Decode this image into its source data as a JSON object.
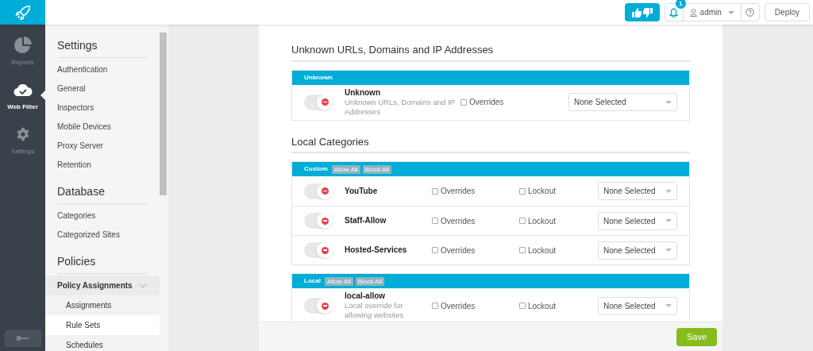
{
  "topbar": {
    "notification_count": "1",
    "user": "admin",
    "deploy": "Deploy"
  },
  "nav": [
    {
      "label": "Reports",
      "kind": "pie",
      "selected": false
    },
    {
      "label": "Web Filter",
      "kind": "cloud",
      "selected": true
    },
    {
      "label": "Settings",
      "kind": "gear",
      "selected": false
    }
  ],
  "sidebar": {
    "sections": [
      {
        "title": "Settings",
        "items": [
          {
            "label": "Authentication",
            "selected": false
          },
          {
            "label": "General",
            "selected": false
          },
          {
            "label": "Inspectors",
            "selected": false
          },
          {
            "label": "Mobile Devices",
            "selected": false
          },
          {
            "label": "Proxy Server",
            "selected": false
          },
          {
            "label": "Retention",
            "selected": false
          }
        ]
      },
      {
        "title": "Database",
        "items": [
          {
            "label": "Categories",
            "selected": false
          },
          {
            "label": "Categorized Sites",
            "selected": false
          }
        ]
      },
      {
        "title": "Policies",
        "items": [
          {
            "label": "Policy Assignments",
            "selected": false,
            "expanded": true,
            "children": [
              {
                "label": "Assignments",
                "selected": false
              },
              {
                "label": "Rule Sets",
                "selected": true
              },
              {
                "label": "Schedules",
                "selected": false
              }
            ]
          }
        ]
      }
    ]
  },
  "sections": [
    {
      "title": "Unknown URLs, Domains and IP Addresses",
      "groups": [
        {
          "title": "Unknown",
          "rows": [
            {
              "name": "Unknown",
              "description": "Unknown URLs, Domains and IP Addresses",
              "blocked": true,
              "overrides": {
                "label": "Overrides",
                "checked": false
              },
              "select": "None Selected"
            }
          ]
        }
      ]
    },
    {
      "title": "Local Categories",
      "groups": [
        {
          "title": "Custom",
          "actions": [
            "Allow All",
            "Block All"
          ],
          "rows": [
            {
              "name": "YouTube",
              "blocked": true,
              "overrides": {
                "label": "Overrides",
                "checked": false
              },
              "lockout": {
                "label": "Lockout",
                "checked": false
              },
              "select": "None Selected"
            },
            {
              "name": "Staff-Allow",
              "blocked": true,
              "overrides": {
                "label": "Overrides",
                "checked": false
              },
              "lockout": {
                "label": "Lockout",
                "checked": false
              },
              "select": "None Selected"
            },
            {
              "name": "Hosted-Services",
              "blocked": true,
              "overrides": {
                "label": "Overrides",
                "checked": false
              },
              "lockout": {
                "label": "Lockout",
                "checked": false
              },
              "select": "None Selected"
            }
          ]
        },
        {
          "title": "Local",
          "actions": [
            "Allow All",
            "Block All"
          ],
          "rows": [
            {
              "name": "local-allow",
              "description": "Local override for allowing websites",
              "blocked": true,
              "overrides": {
                "label": "Overrides",
                "checked": false
              },
              "lockout": {
                "label": "Lockout",
                "checked": false
              },
              "select": "None Selected"
            }
          ]
        }
      ]
    }
  ],
  "footer": {
    "save": "Save"
  }
}
